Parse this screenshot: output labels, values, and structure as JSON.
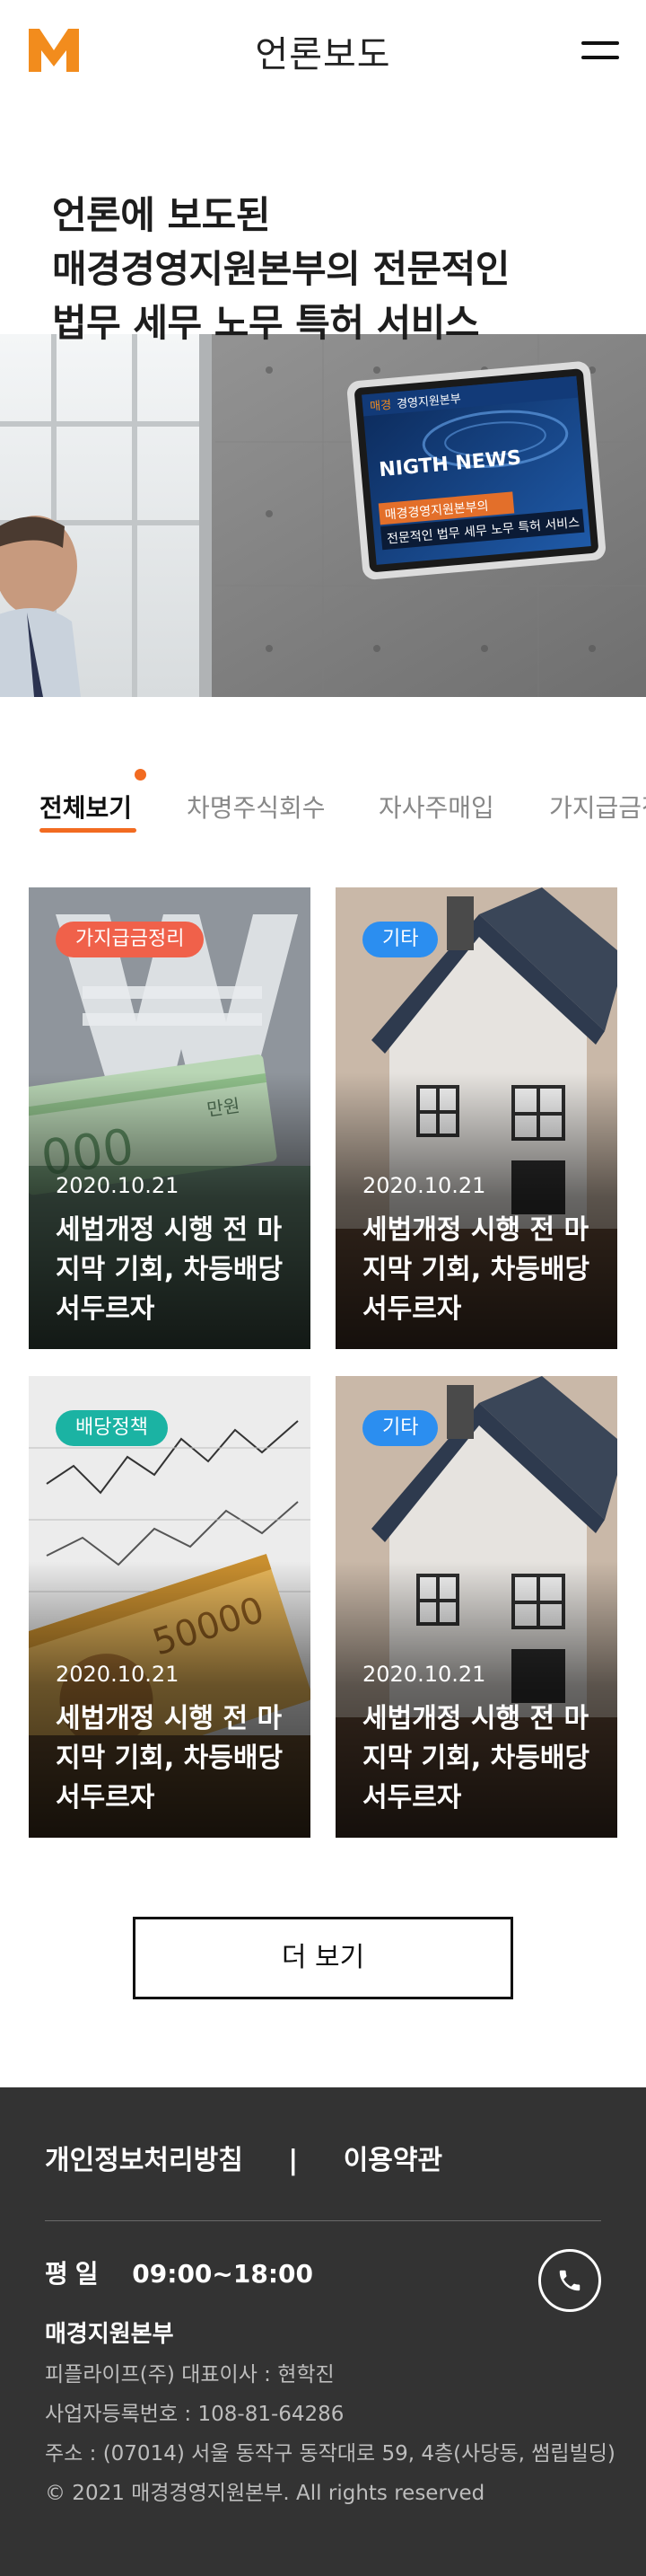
{
  "header": {
    "logo_text": "M",
    "title": "언론보도",
    "logo_color": "#f28c1d"
  },
  "hero": {
    "title_lines": [
      "언론에 보도된",
      "매경경영지원본부의 전문적인",
      "법무 세무 노무 특허 서비스"
    ],
    "tv_brand_prefix": "매경",
    "tv_brand_suffix": "경영지원본부",
    "tv_news": "NIGTH NEWS",
    "tv_caption_1": "매경경영지원본부의",
    "tv_caption_2": "전문적인 법무 세무 노무 특허 서비스"
  },
  "tabs": [
    {
      "label": "전체보기",
      "active": true
    },
    {
      "label": "차명주식회수",
      "active": false
    },
    {
      "label": "자사주매입",
      "active": false
    },
    {
      "label": "가지급금정리",
      "active": false
    }
  ],
  "cards": [
    {
      "badge": "가지급금정리",
      "badge_color": "#f0614a",
      "date": "2020.10.21",
      "text": "세법개정 시행 전 마지막 기회, 차등배당 서두르자",
      "image": "won-money"
    },
    {
      "badge": "기타",
      "badge_color": "#2b8ef0",
      "date": "2020.10.21",
      "text": "세법개정 시행 전 마지막 기회, 차등배당 서두르자",
      "image": "house-model"
    },
    {
      "badge": "배당정책",
      "badge_color": "#1bb3a3",
      "date": "2020.10.21",
      "text": "세법개정 시행 전 마지막 기회, 차등배당 서두르자",
      "image": "banknote-chart"
    },
    {
      "badge": "기타",
      "badge_color": "#2b8ef0",
      "date": "2020.10.21",
      "text": "세법개정 시행 전 마지막 기회, 차등배당 서두르자",
      "image": "house-model"
    }
  ],
  "more_button": "더 보기",
  "footer": {
    "privacy": "개인정보처리방침",
    "separator": "|",
    "terms": "이용약관",
    "hours_label": "평일",
    "hours_value": "09:00~18:00",
    "company": "매경지원본부",
    "info_1": "피플라이프(주) 대표이사 : 현학진",
    "info_2": "사업자등록번호 : 108-81-64286",
    "info_3": "주소 : (07014) 서울 동작구 동작대로 59, 4층(사당동, 썸립빌딩)",
    "copyright": "© 2021 매경경영지원본부. All rights reserved"
  },
  "icons": {
    "logo": "m-logo-icon",
    "menu": "hamburger-menu-icon",
    "phone": "phone-icon"
  }
}
